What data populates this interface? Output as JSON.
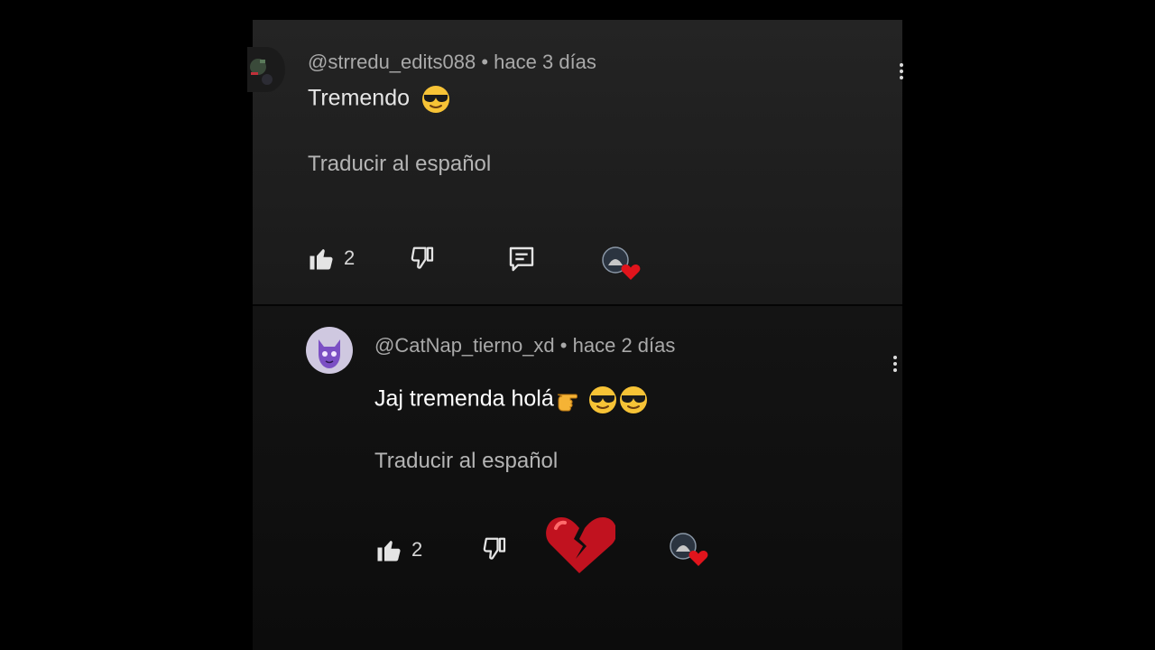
{
  "comments": [
    {
      "author": "@strredu_edits088",
      "time": "hace 3 días",
      "text": "Tremendo",
      "translate_label": "Traducir al español",
      "likes": "2"
    },
    {
      "author": "@CatNap_tierno_xd",
      "time": "hace 2 días",
      "text": "Jaj tremenda holá",
      "translate_label": "Traducir al español",
      "likes": "2"
    }
  ],
  "separator": "•",
  "colors": {
    "background": "#000000",
    "top_card": "#222222",
    "bottom_card": "#0e0e0e",
    "heart_red": "#e0141c",
    "broken_heart": "#c1121f"
  },
  "icons": [
    "like-icon",
    "dislike-icon",
    "reply-icon",
    "creator-heart-icon",
    "sunglasses-emoji-icon",
    "pointing-hand-emoji-icon",
    "broken-heart-emoji-icon",
    "more-options-icon"
  ]
}
